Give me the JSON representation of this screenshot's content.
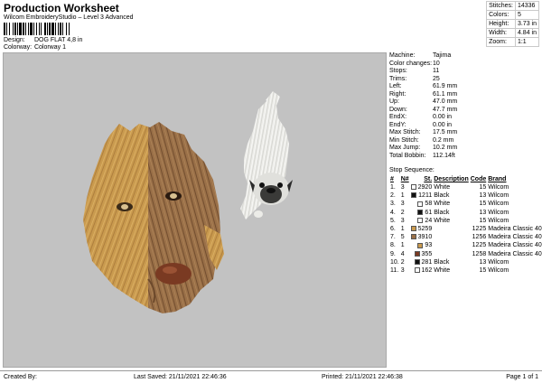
{
  "header": {
    "title": "Production Worksheet",
    "subtitle": "Wilcom EmbroideryStudio – Level 3 Advanced",
    "design_label": "Design:",
    "design_value": "DOG FLAT 4,8 in",
    "colorway_label": "Colorway:",
    "colorway_value": "Colorway 1"
  },
  "stats": [
    {
      "label": "Stitches:",
      "value": "14336"
    },
    {
      "label": "Colors:",
      "value": "5"
    },
    {
      "label": "Height:",
      "value": "3.73 in"
    },
    {
      "label": "Width:",
      "value": "4.84 in"
    },
    {
      "label": "Zoom:",
      "value": "1:1"
    }
  ],
  "machine_info": [
    {
      "label": "Machine:",
      "value": "Tajima"
    },
    {
      "label": "Color changes:",
      "value": "10"
    },
    {
      "label": "Stops:",
      "value": "11"
    },
    {
      "label": "Trims:",
      "value": "25"
    },
    {
      "label": "Left:",
      "value": "61.9 mm"
    },
    {
      "label": "Right:",
      "value": "61.1 mm"
    },
    {
      "label": "Up:",
      "value": "47.0 mm"
    },
    {
      "label": "Down:",
      "value": "47.7 mm"
    },
    {
      "label": "EndX:",
      "value": "0.00 in"
    },
    {
      "label": "EndY:",
      "value": "0.00 in"
    },
    {
      "label": "Max Stitch:",
      "value": "17.5 mm"
    },
    {
      "label": "Min Stitch:",
      "value": "0.2 mm"
    },
    {
      "label": "Max Jump:",
      "value": "10.2 mm"
    },
    {
      "label": "Total Bobbin:",
      "value": "112.14ft"
    }
  ],
  "stop_sequence": {
    "title": "Stop Sequence:",
    "headers": [
      "#",
      "N#",
      "St.",
      "Description",
      "Code",
      "Brand"
    ],
    "rows": [
      {
        "n": "1.",
        "needle": "3",
        "color": "#ffffff",
        "st": "2920",
        "desc": "White",
        "code": "15",
        "brand": "Wilcom"
      },
      {
        "n": "2.",
        "needle": "1",
        "color": "#111111",
        "st": "1211",
        "desc": "Black",
        "code": "13",
        "brand": "Wilcom"
      },
      {
        "n": "3.",
        "needle": "3",
        "color": "#ffffff",
        "st": "58",
        "desc": "White",
        "code": "15",
        "brand": "Wilcom"
      },
      {
        "n": "4.",
        "needle": "2",
        "color": "#111111",
        "st": "61",
        "desc": "Black",
        "code": "13",
        "brand": "Wilcom"
      },
      {
        "n": "5.",
        "needle": "3",
        "color": "#ffffff",
        "st": "24",
        "desc": "White",
        "code": "15",
        "brand": "Wilcom"
      },
      {
        "n": "6.",
        "needle": "1",
        "color": "#c99a4e",
        "st": "5259",
        "desc": "",
        "code": "1225",
        "brand": "Madeira Classic 40"
      },
      {
        "n": "7.",
        "needle": "5",
        "color": "#9a7048",
        "st": "3910",
        "desc": "",
        "code": "1256",
        "brand": "Madeira Classic 40"
      },
      {
        "n": "8.",
        "needle": "1",
        "color": "#c99a4e",
        "st": "93",
        "desc": "",
        "code": "1225",
        "brand": "Madeira Classic 40"
      },
      {
        "n": "9.",
        "needle": "4",
        "color": "#7a3a22",
        "st": "355",
        "desc": "",
        "code": "1258",
        "brand": "Madeira Classic 40"
      },
      {
        "n": "10.",
        "needle": "2",
        "color": "#111111",
        "st": "281",
        "desc": "Black",
        "code": "13",
        "brand": "Wilcom"
      },
      {
        "n": "11.",
        "needle": "3",
        "color": "#ffffff",
        "st": "162",
        "desc": "White",
        "code": "15",
        "brand": "Wilcom"
      }
    ]
  },
  "footer": {
    "created_by": "Created By:",
    "last_saved": "Last Saved: 21/11/2021 22:46:36",
    "printed": "Printed: 21/11/2021 22:46:38",
    "page": "Page 1 of 1"
  },
  "colors": {
    "canvas_bg": "#c2c2c2",
    "fur_light": "#c99a4e",
    "fur_dark": "#9a7048",
    "nose": "#7a3a22",
    "pug_body": "#e8e8e4"
  }
}
